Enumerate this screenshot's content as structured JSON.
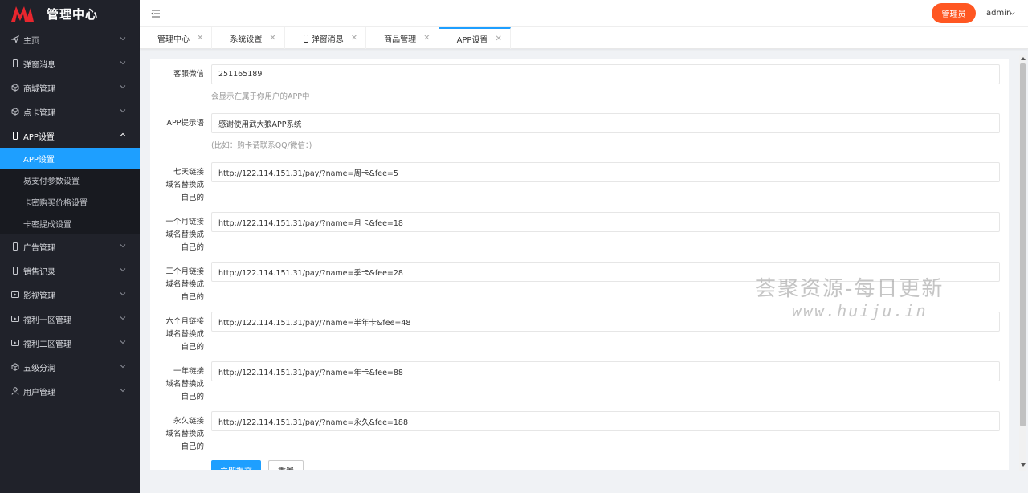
{
  "brand": {
    "title": "管理中心",
    "accent": "#e8262e"
  },
  "sidebar": {
    "items": [
      {
        "label": "主页",
        "icon": "send-icon"
      },
      {
        "label": "弹窗消息",
        "icon": "phone-icon"
      },
      {
        "label": "商城管理",
        "icon": "box-icon"
      },
      {
        "label": "点卡管理",
        "icon": "box-icon"
      },
      {
        "label": "APP设置",
        "icon": "phone-icon"
      },
      {
        "label": "广告管理",
        "icon": "phone-icon"
      },
      {
        "label": "销售记录",
        "icon": "phone-icon"
      },
      {
        "label": "影视管理",
        "icon": "play-icon"
      },
      {
        "label": "福利一区管理",
        "icon": "play-icon"
      },
      {
        "label": "福利二区管理",
        "icon": "play-icon"
      },
      {
        "label": "五级分润",
        "icon": "box-icon"
      },
      {
        "label": "用户管理",
        "icon": "user-icon"
      }
    ],
    "submenu": [
      {
        "label": "APP设置",
        "active": true
      },
      {
        "label": "易支付参数设置"
      },
      {
        "label": "卡密购买价格设置"
      },
      {
        "label": "卡密提成设置"
      }
    ]
  },
  "header": {
    "role_label": "管理员",
    "user_name": "admin",
    "role_color": "#ff5722"
  },
  "tabs": [
    {
      "label": "管理中心",
      "close": "✕"
    },
    {
      "label": "系统设置",
      "close": "✕"
    },
    {
      "label": "弹窗消息",
      "close": "✕",
      "icon": "phone-icon"
    },
    {
      "label": "商品管理",
      "close": "✕"
    },
    {
      "label": "APP设置",
      "close": "✕",
      "active": true
    }
  ],
  "form": {
    "fields": [
      {
        "label": "客服微信",
        "value": "251165189",
        "hint": "会显示在属于你用户的APP中"
      },
      {
        "label": "APP提示语",
        "value": "感谢使用武大狼APP系统",
        "hint": "(比如：购卡请联系QQ/微信：)"
      },
      {
        "label_lines": [
          "七天链接",
          "域名替换成",
          "自己的"
        ],
        "value": "http://122.114.151.31/pay/?name=周卡&fee=5"
      },
      {
        "label_lines": [
          "一个月链接",
          "域名替换成",
          "自己的"
        ],
        "value": "http://122.114.151.31/pay/?name=月卡&fee=18"
      },
      {
        "label_lines": [
          "三个月链接",
          "域名替换成",
          "自己的"
        ],
        "value": "http://122.114.151.31/pay/?name=季卡&fee=28"
      },
      {
        "label_lines": [
          "六个月链接",
          "域名替换成",
          "自己的"
        ],
        "value": "http://122.114.151.31/pay/?name=半年卡&fee=48"
      },
      {
        "label_lines": [
          "一年链接",
          "域名替换成",
          "自己的"
        ],
        "value": "http://122.114.151.31/pay/?name=年卡&fee=88"
      },
      {
        "label_lines": [
          "永久链接",
          "域名替换成",
          "自己的"
        ],
        "value": "http://122.114.151.31/pay/?name=永久&fee=188"
      }
    ],
    "submit_label": "立即提交",
    "reset_label": "重置"
  },
  "watermark": {
    "line1": "荟聚资源-每日更新",
    "line2": "www.huiju.in"
  }
}
